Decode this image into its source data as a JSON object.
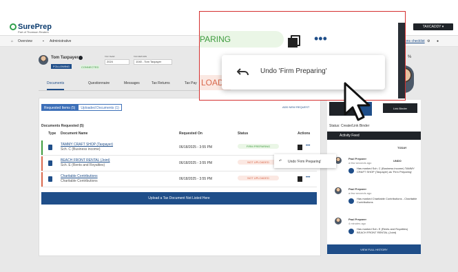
{
  "app": {
    "logo": "SurePrep",
    "logo_sub": "Part of Thomson Reuters",
    "tax_dropdown": "TAXCADDY ▾",
    "checklist": "ons checklist"
  },
  "nav": {
    "overview": "Overview",
    "administrative": "Administrative"
  },
  "client": {
    "name": "Tom Taxpayer",
    "following": "FOLLOWING",
    "connected": "CONNECTED",
    "tax_year_label": "TAX YEAR",
    "tax_year": "2024",
    "tax_return_label": "TAX RETURN",
    "tax_return": "1040 - Tom Taxpayer"
  },
  "tabs": [
    "Documents",
    "Questionnaire",
    "Messages",
    "Tax Returns",
    "Tax Pay"
  ],
  "segments": {
    "requested": "Requested Items (5)",
    "uploaded": "Uploaded Documents (1)",
    "add": "ADD NEW REQUEST"
  },
  "table": {
    "title": "Documents Requested (5)",
    "headers": [
      "Type",
      "Document Name",
      "Requested On",
      "Status",
      "Actions"
    ],
    "rows": [
      {
        "name": "TAMMY CRAFT SHOP (Taxpayer)",
        "sub": "Sch. C (Business income)",
        "date": "06/18/2025 - 3:55 PM",
        "status": "FIRM PREPARING",
        "color": "#3c9a3c"
      },
      {
        "name": "BEACH FRONT RENTAL (Joint)",
        "sub": "Sch. E (Rents and Royalties)",
        "date": "06/18/2025 - 3:55 PM",
        "status": "NOT UPLOADED",
        "color": "#d9684c"
      },
      {
        "name": "Charitable Contributions",
        "sub": "Charitable Contributions",
        "date": "06/18/2025 - 3:55 PM",
        "status": "NOT UPLOADED",
        "color": "#d9684c"
      }
    ]
  },
  "upload_btn": "Upload a Tax Document Not Listed Here",
  "right": {
    "link_binder": "Link Binder",
    "status_line": "Status: Create/Link Binder",
    "activity": "Activity Feed",
    "today": "TODAY",
    "undo": "UNDO",
    "feed": [
      {
        "who": "Paul Preparer",
        "when": "a few seconds ago",
        "text": "Has marked Sch. C (Business income) TAMMY CRAFT SHOP (Taxpayer) as 'Firm Preparing'"
      },
      {
        "who": "Paul Preparer",
        "when": "a few seconds ago",
        "text": "Has marked Charitable Contributions - Charitable Contributions"
      },
      {
        "who": "Paul Preparer",
        "when": "4 minutes ago",
        "text": "Has marked Sch. E (Rents and Royalties) BEACH FRONT RENTAL (Joint)"
      }
    ],
    "view_full": "VIEW FULL HISTORY"
  },
  "zoom": {
    "status_partial": "PARING",
    "not_uploaded_partial": "LOADE",
    "undo_menu": "Undo 'Firm Preparing'",
    "small_undo": "Undo 'Firm Preparing'"
  },
  "misc": {
    "pct": "%"
  }
}
